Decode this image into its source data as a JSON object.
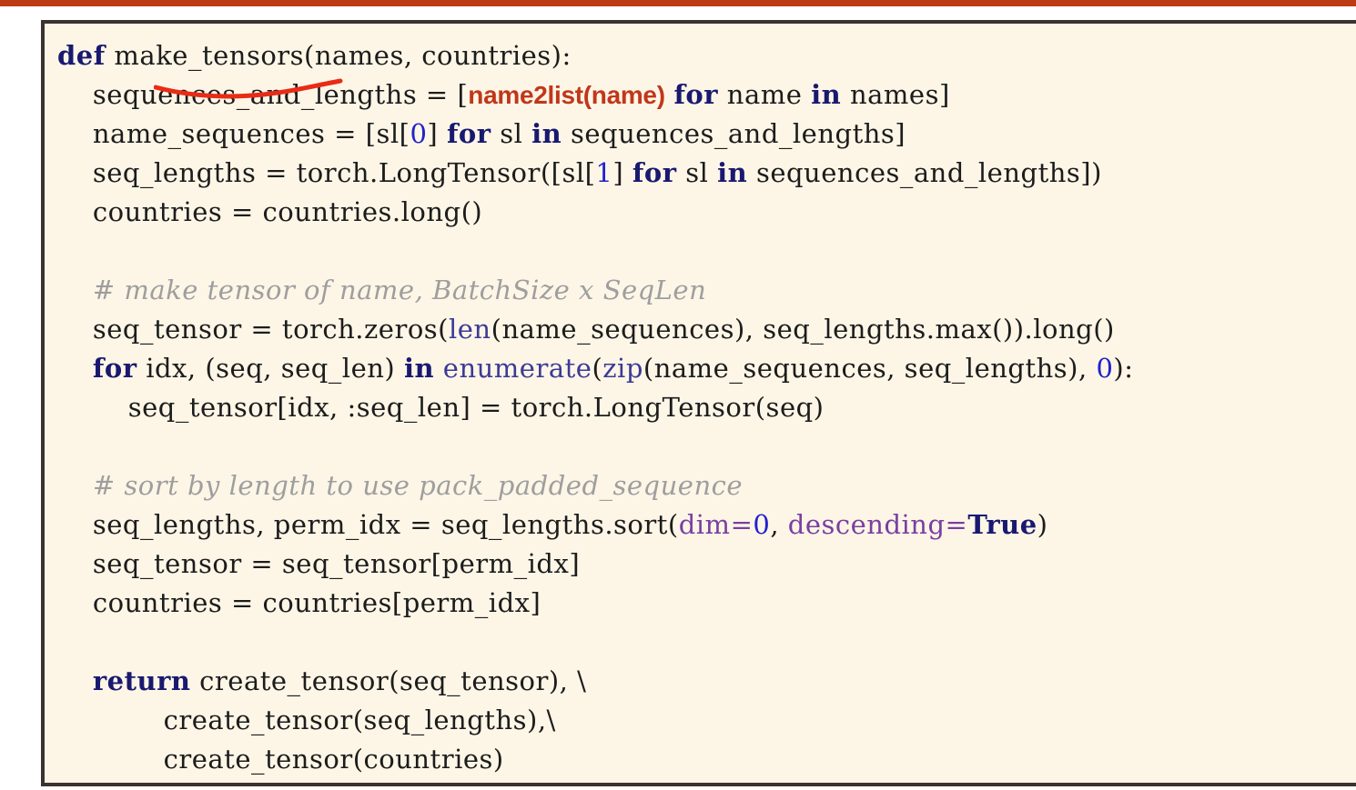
{
  "slide": {
    "background_color": "#ffffff",
    "accent_bar_color": "#be3a12",
    "panel_background": "#fdf6e7",
    "panel_border_color": "#3a3330"
  },
  "annotation": {
    "type": "hand-drawn-underline",
    "color": "#e82c16",
    "target_text": "make_tensors"
  },
  "palette": {
    "keyword": "#191970",
    "builtin": "#3b3b96",
    "number": "#2222cc",
    "constant": "#191970",
    "parameter": "#7a3fa0",
    "comment": "#9e9e9e",
    "plain": "#1c1c1c",
    "highlight": "#c1371a"
  },
  "code": {
    "language": "python",
    "lines": [
      {
        "id": "line-1",
        "tokens": [
          {
            "t": "def",
            "c": "kw"
          },
          {
            "t": " make_tensors(names, countries):",
            "c": "plain"
          }
        ]
      },
      {
        "id": "line-2",
        "tokens": [
          {
            "t": "    sequences_and_lengths = [",
            "c": "plain"
          },
          {
            "t": "name2list(name)",
            "c": "highlight"
          },
          {
            "t": " ",
            "c": "plain"
          },
          {
            "t": "for",
            "c": "kw"
          },
          {
            "t": " name ",
            "c": "plain"
          },
          {
            "t": "in",
            "c": "kw"
          },
          {
            "t": " names]",
            "c": "plain"
          }
        ]
      },
      {
        "id": "line-3",
        "tokens": [
          {
            "t": "    name_sequences = [sl[",
            "c": "plain"
          },
          {
            "t": "0",
            "c": "num"
          },
          {
            "t": "] ",
            "c": "plain"
          },
          {
            "t": "for",
            "c": "kw"
          },
          {
            "t": " sl ",
            "c": "plain"
          },
          {
            "t": "in",
            "c": "kw"
          },
          {
            "t": " sequences_and_lengths]",
            "c": "plain"
          }
        ]
      },
      {
        "id": "line-4",
        "tokens": [
          {
            "t": "    seq_lengths = torch.LongTensor([sl[",
            "c": "plain"
          },
          {
            "t": "1",
            "c": "num"
          },
          {
            "t": "] ",
            "c": "plain"
          },
          {
            "t": "for",
            "c": "kw"
          },
          {
            "t": " sl ",
            "c": "plain"
          },
          {
            "t": "in",
            "c": "kw"
          },
          {
            "t": " sequences_and_lengths])",
            "c": "plain"
          }
        ]
      },
      {
        "id": "line-5",
        "tokens": [
          {
            "t": "    countries = countries.long()",
            "c": "plain"
          }
        ]
      },
      {
        "id": "line-6",
        "blank": true,
        "tokens": []
      },
      {
        "id": "line-7",
        "tokens": [
          {
            "t": "    # make tensor of name, BatchSize x SeqLen",
            "c": "comment"
          }
        ]
      },
      {
        "id": "line-8",
        "tokens": [
          {
            "t": "    seq_tensor = torch.zeros(",
            "c": "plain"
          },
          {
            "t": "len",
            "c": "builtin"
          },
          {
            "t": "(name_sequences), seq_lengths.max()).long()",
            "c": "plain"
          }
        ]
      },
      {
        "id": "line-9",
        "tokens": [
          {
            "t": "    ",
            "c": "plain"
          },
          {
            "t": "for",
            "c": "kw"
          },
          {
            "t": " idx, (seq, seq_len) ",
            "c": "plain"
          },
          {
            "t": "in",
            "c": "kw"
          },
          {
            "t": " ",
            "c": "plain"
          },
          {
            "t": "enumerate",
            "c": "builtin"
          },
          {
            "t": "(",
            "c": "plain"
          },
          {
            "t": "zip",
            "c": "builtin"
          },
          {
            "t": "(name_sequences, seq_lengths), ",
            "c": "plain"
          },
          {
            "t": "0",
            "c": "num"
          },
          {
            "t": "):",
            "c": "plain"
          }
        ]
      },
      {
        "id": "line-10",
        "tokens": [
          {
            "t": "        seq_tensor[idx, :seq_len] = torch.LongTensor(seq)",
            "c": "plain"
          }
        ]
      },
      {
        "id": "line-11",
        "blank": true,
        "tokens": []
      },
      {
        "id": "line-12",
        "tokens": [
          {
            "t": "    # sort by length to use pack_padded_sequence",
            "c": "comment"
          }
        ]
      },
      {
        "id": "line-13",
        "tokens": [
          {
            "t": "    seq_lengths, perm_idx = seq_lengths.sort(",
            "c": "plain"
          },
          {
            "t": "dim",
            "c": "param"
          },
          {
            "t": "=",
            "c": "param"
          },
          {
            "t": "0",
            "c": "num"
          },
          {
            "t": ", ",
            "c": "plain"
          },
          {
            "t": "descending",
            "c": "param"
          },
          {
            "t": "=",
            "c": "param"
          },
          {
            "t": "True",
            "c": "const"
          },
          {
            "t": ")",
            "c": "plain"
          }
        ]
      },
      {
        "id": "line-14",
        "tokens": [
          {
            "t": "    seq_tensor = seq_tensor[perm_idx]",
            "c": "plain"
          }
        ]
      },
      {
        "id": "line-15",
        "tokens": [
          {
            "t": "    countries = countries[perm_idx]",
            "c": "plain"
          }
        ]
      },
      {
        "id": "line-16",
        "blank": true,
        "tokens": []
      },
      {
        "id": "line-17",
        "tokens": [
          {
            "t": "    ",
            "c": "plain"
          },
          {
            "t": "return",
            "c": "kw"
          },
          {
            "t": " create_tensor(seq_tensor), \\",
            "c": "plain"
          }
        ]
      },
      {
        "id": "line-18",
        "tokens": [
          {
            "t": "            create_tensor(seq_lengths),\\",
            "c": "plain"
          }
        ]
      },
      {
        "id": "line-19",
        "tokens": [
          {
            "t": "            create_tensor(countries)",
            "c": "plain"
          }
        ]
      }
    ]
  }
}
